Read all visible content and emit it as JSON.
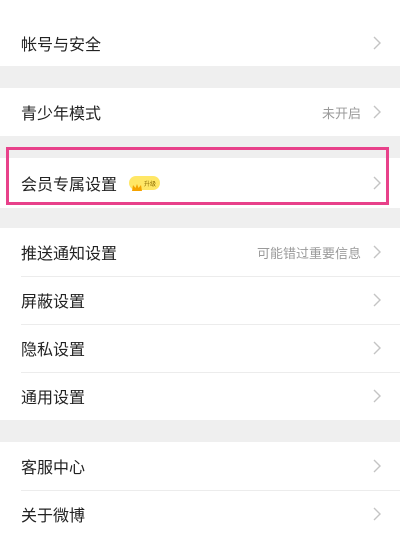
{
  "settings": {
    "group1": [
      {
        "label": "帐号与安全",
        "value": ""
      }
    ],
    "group2": [
      {
        "label": "青少年模式",
        "value": "未开启"
      }
    ],
    "group3": [
      {
        "label": "会员专属设置",
        "value": "",
        "badge": "升级"
      }
    ],
    "group4": [
      {
        "label": "推送通知设置",
        "value": "可能错过重要信息"
      },
      {
        "label": "屏蔽设置",
        "value": ""
      },
      {
        "label": "隐私设置",
        "value": ""
      },
      {
        "label": "通用设置",
        "value": ""
      }
    ],
    "group5": [
      {
        "label": "客服中心",
        "value": ""
      },
      {
        "label": "关于微博",
        "value": ""
      }
    ]
  },
  "colors": {
    "highlight": "#e8418a",
    "badge_bg": "#ffe766"
  }
}
